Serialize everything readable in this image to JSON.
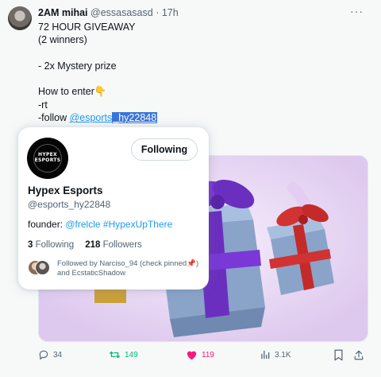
{
  "tweet": {
    "author_name": "2AM mihai",
    "author_handle": "@essasasasd",
    "separator": "·",
    "time": "17h",
    "more_glyph": "···",
    "lines": {
      "l1": "72 HOUR GIVEAWAY",
      "l2": "(2 winners)",
      "l3": "- 2x Mystery prize",
      "l4": "How to enter",
      "l4_emoji": "👇",
      "l5": "-rt",
      "l6_prefix": "-follow ",
      "l6_link": "@esports",
      "l6_link_selected": "_hy22848"
    }
  },
  "hovercard": {
    "logo_text": "HYPEX ESPORTS",
    "follow_label": "Following",
    "name": "Hypex Esports",
    "handle": "@esports_hy22848",
    "bio_prefix": "founder: ",
    "bio_mention": "@frelcle",
    "bio_space": " ",
    "bio_hashtag": "#HypexUpThere",
    "following_count": "3",
    "following_label": " Following",
    "followers_count": "218",
    "followers_label": " Followers",
    "followed_by": "Followed by Narciso_94 (check pinned📌) and EcstaticShadow"
  },
  "actions": {
    "replies": "34",
    "retweets": "149",
    "likes": "119",
    "views": "3.1K"
  },
  "icons": {
    "reply": "reply-icon",
    "retweet": "retweet-icon",
    "like": "heart-icon",
    "views": "views-icon",
    "bookmark": "bookmark-icon",
    "share": "share-icon"
  },
  "colors": {
    "link_blue": "#1d9bf0",
    "retweet_green": "#00ba7c",
    "like_pink": "#f91880",
    "selection_blue": "#3874d8"
  }
}
